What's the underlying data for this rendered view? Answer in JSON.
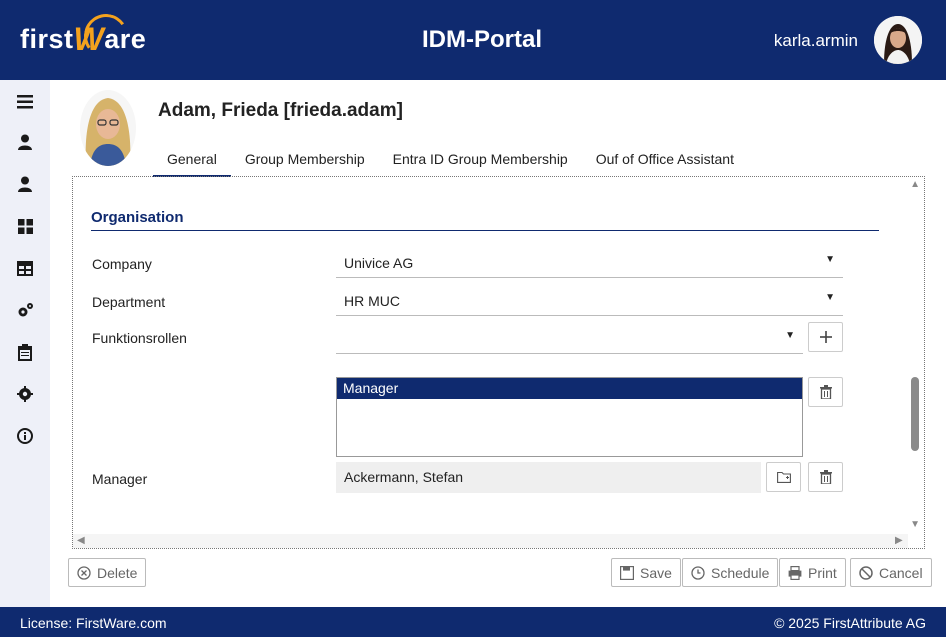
{
  "header": {
    "logo_text_1": "first",
    "logo_text_w": "W",
    "logo_text_2": "are",
    "app_title": "IDM-Portal",
    "username": "karla.armin"
  },
  "sidebar": {
    "items": [
      {
        "icon": "menu-icon"
      },
      {
        "icon": "user-icon"
      },
      {
        "icon": "user-icon"
      },
      {
        "icon": "dashboard-icon"
      },
      {
        "icon": "org-icon"
      },
      {
        "icon": "cogs-icon"
      },
      {
        "icon": "clipboard-icon"
      },
      {
        "icon": "gear-icon"
      },
      {
        "icon": "info-icon"
      }
    ]
  },
  "profile": {
    "title": "Adam, Frieda [frieda.adam]"
  },
  "tabs": [
    {
      "label": "General",
      "active": true
    },
    {
      "label": "Group Membership",
      "active": false
    },
    {
      "label": "Entra ID Group Membership",
      "active": false
    },
    {
      "label": "Ouf of Office Assistant",
      "active": false
    }
  ],
  "section": {
    "title": "Organisation"
  },
  "form": {
    "company_label": "Company",
    "company_value": "Univice AG",
    "department_label": "Department",
    "department_value": "HR MUC",
    "funktionsrollen_label": "Funktionsrollen",
    "funktionsrollen_value": "",
    "roles_list": [
      "Manager"
    ],
    "manager_label": "Manager",
    "manager_value": "Ackermann, Stefan"
  },
  "actions": {
    "delete": "Delete",
    "save": "Save",
    "schedule": "Schedule",
    "print": "Print",
    "cancel": "Cancel"
  },
  "footer": {
    "license": "License: FirstWare.com",
    "copyright": "© 2025 FirstAttribute AG"
  },
  "colors": {
    "brand": "#0f2a6f",
    "accent": "#f4a21e",
    "sidebar_bg": "#eef0f8"
  }
}
